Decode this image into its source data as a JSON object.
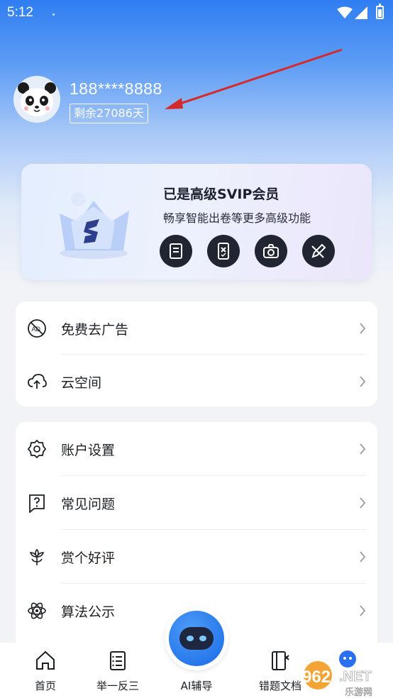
{
  "status_bar": {
    "time": "5:12"
  },
  "profile": {
    "phone": "188****8888",
    "remaining": "剩余27086天"
  },
  "vip": {
    "title": "已是高级SVIP会员",
    "subtitle": "畅享智能出卷等更多高级功能"
  },
  "menu_group_1": [
    {
      "label": "免费去广告",
      "icon": "no-ads-icon"
    },
    {
      "label": "云空间",
      "icon": "cloud-upload-icon"
    }
  ],
  "menu_group_2": [
    {
      "label": "账户设置",
      "icon": "gear-icon"
    },
    {
      "label": "常见问题",
      "icon": "question-icon"
    },
    {
      "label": "赏个好评",
      "icon": "flower-icon"
    },
    {
      "label": "算法公示",
      "icon": "atom-icon"
    }
  ],
  "tabbar": {
    "home": "首页",
    "analogy": "举一反三",
    "ai": "AI辅导",
    "wrong_docs": "错题文档"
  },
  "watermark": {
    "brand": "962.NET",
    "sub": "乐游网"
  }
}
